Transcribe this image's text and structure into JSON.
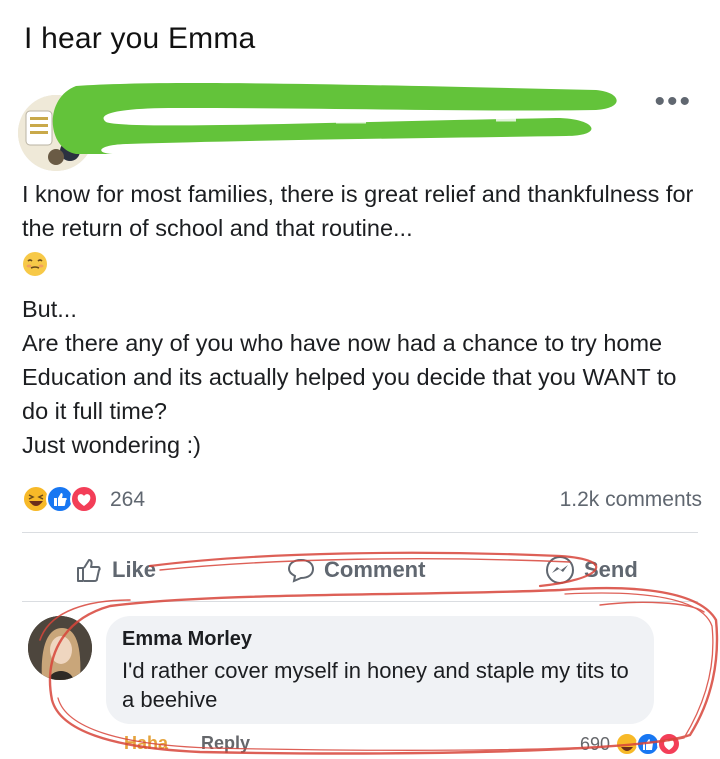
{
  "caption": "I hear you Emma",
  "post": {
    "more_menu": "•••",
    "lines": [
      "I know for most families, there is great relief and thankfulness for the return of school and that routine...",
      "But...",
      "Are there any of you who have now had a chance to try home Education and its actually helped you decide that you WANT to do it full time?",
      "Just wondering :)"
    ],
    "inline_emoji": "relieved-face-icon",
    "reaction_count": "264",
    "comment_count": "1.2k comments"
  },
  "actions": {
    "like": "Like",
    "comment": "Comment",
    "send": "Send"
  },
  "comment": {
    "author": "Emma Morley",
    "text": "I'd rather cover myself in honey and staple my tits to a beehive",
    "reaction_label": "Haha",
    "reply_label": "Reply",
    "reaction_count": "690"
  },
  "colors": {
    "redaction_green": "#63c33a",
    "scribble_red": "#d8453a",
    "facebook_blue": "#1877f2",
    "love_red": "#f33e58",
    "haha_yellow": "#f7b928"
  }
}
